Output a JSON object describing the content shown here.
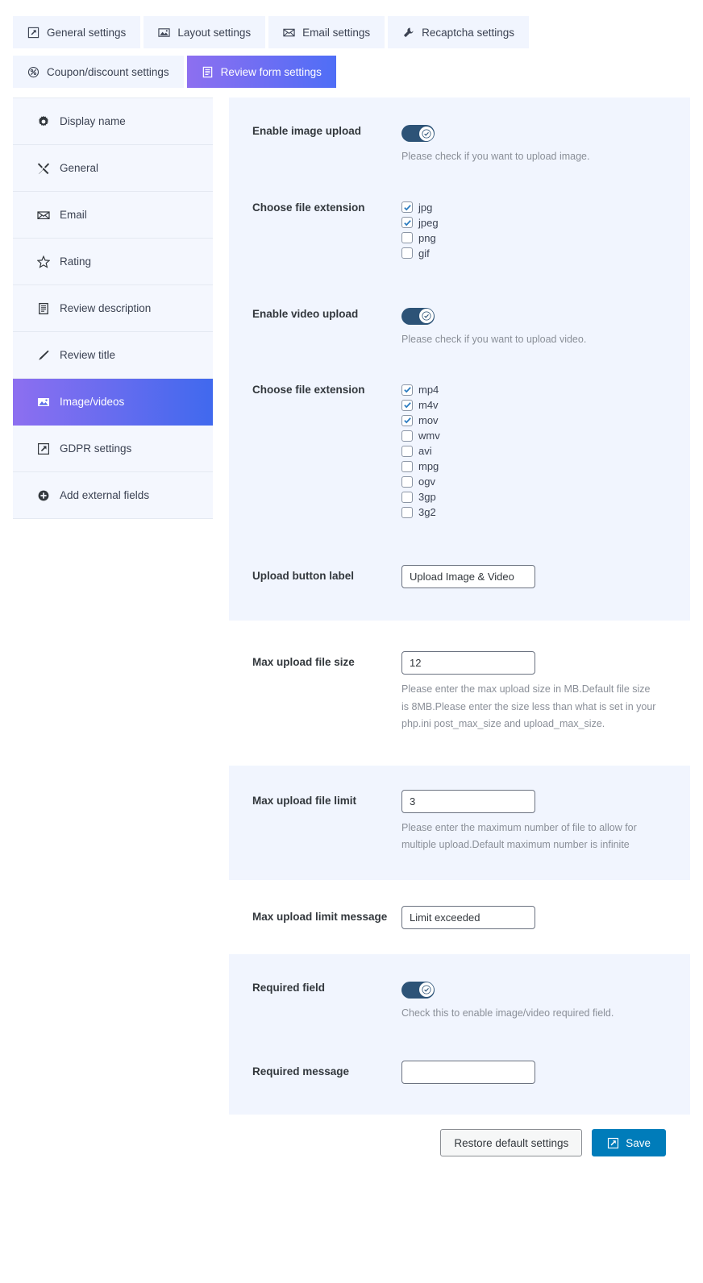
{
  "tabs": [
    {
      "label": "General settings",
      "icon": "external-link-icon",
      "active": false
    },
    {
      "label": "Layout settings",
      "icon": "image-icon",
      "active": false
    },
    {
      "label": "Email settings",
      "icon": "envelope-icon",
      "active": false
    },
    {
      "label": "Recaptcha settings",
      "icon": "wrench-icon",
      "active": false
    },
    {
      "label": "Coupon/discount settings",
      "icon": "discount-icon",
      "active": false
    },
    {
      "label": "Review form settings",
      "icon": "list-document-icon",
      "active": true
    }
  ],
  "sidebar": {
    "items": [
      {
        "label": "Display name",
        "icon": "gear-icon",
        "active": false
      },
      {
        "label": "General",
        "icon": "tools-icon",
        "active": false
      },
      {
        "label": "Email",
        "icon": "envelope-icon",
        "active": false
      },
      {
        "label": "Rating",
        "icon": "star-icon",
        "active": false
      },
      {
        "label": "Review description",
        "icon": "list-document-icon",
        "active": false
      },
      {
        "label": "Review title",
        "icon": "pencil-icon",
        "active": false
      },
      {
        "label": "Image/videos",
        "icon": "image-icon",
        "active": true
      },
      {
        "label": "GDPR settings",
        "icon": "external-link-icon",
        "active": false
      },
      {
        "label": "Add external fields",
        "icon": "plus-circle-icon",
        "active": false
      }
    ]
  },
  "form": {
    "enable_image_upload": {
      "label": "Enable image upload",
      "toggle_on": true,
      "help": "Please check if you want to upload image."
    },
    "image_extensions": {
      "label": "Choose file extension",
      "options": [
        {
          "label": "jpg",
          "checked": true
        },
        {
          "label": "jpeg",
          "checked": true
        },
        {
          "label": "png",
          "checked": false
        },
        {
          "label": "gif",
          "checked": false
        }
      ]
    },
    "enable_video_upload": {
      "label": "Enable video upload",
      "toggle_on": true,
      "help": "Please check if you want to upload video."
    },
    "video_extensions": {
      "label": "Choose file extension",
      "options": [
        {
          "label": "mp4",
          "checked": true
        },
        {
          "label": "m4v",
          "checked": true
        },
        {
          "label": "mov",
          "checked": true
        },
        {
          "label": "wmv",
          "checked": false
        },
        {
          "label": "avi",
          "checked": false
        },
        {
          "label": "mpg",
          "checked": false
        },
        {
          "label": "ogv",
          "checked": false
        },
        {
          "label": "3gp",
          "checked": false
        },
        {
          "label": "3g2",
          "checked": false
        }
      ]
    },
    "upload_button_label": {
      "label": "Upload button label",
      "value": "Upload Image & Video",
      "placeholder": ""
    },
    "max_upload_file_size": {
      "label": "Max upload file size",
      "value": "12",
      "placeholder": "",
      "help": "Please enter the max upload size in MB.Default file size is 8MB.Please enter the size less than what is set in your php.ini post_max_size and upload_max_size."
    },
    "max_upload_file_limit": {
      "label": "Max upload file limit",
      "value": "3",
      "placeholder": "",
      "help": "Please enter the maximum number of file to allow for multiple upload.Default maximum number is infinite"
    },
    "max_upload_limit_message": {
      "label": "Max upload limit message",
      "value": "Limit exceeded",
      "placeholder": ""
    },
    "required_field": {
      "label": "Required field",
      "toggle_on": true,
      "help": "Check this to enable image/video required field."
    },
    "required_message": {
      "label": "Required message",
      "value": "",
      "placeholder": ""
    }
  },
  "footer": {
    "restore_label": "Restore default settings",
    "save_label": "Save",
    "save_icon": "external-link-icon"
  },
  "colors": {
    "accent_purple": "#8d6ff0",
    "accent_blue": "#4f6ef6",
    "panel_tint": "#f1f5fe",
    "sidebar_bg": "#f4f7fe",
    "toggle_on": "#2d5377",
    "save_button": "#007cba",
    "checkbox_check": "#2a7bc0"
  }
}
